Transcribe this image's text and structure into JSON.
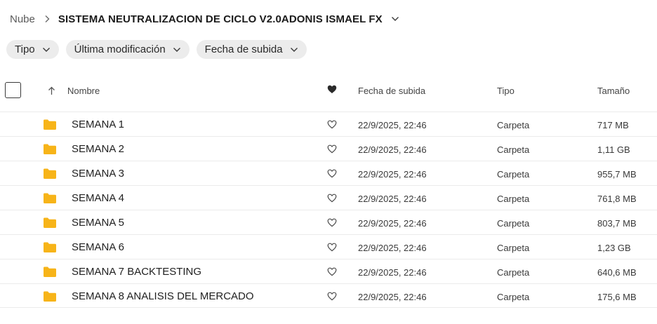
{
  "breadcrumb": {
    "root": "Nube",
    "current": "SISTEMA NEUTRALIZACION DE CICLO V2.0ADONIS ISMAEL FX"
  },
  "filters": [
    {
      "label": "Tipo"
    },
    {
      "label": "Última modificación"
    },
    {
      "label": "Fecha de subida"
    }
  ],
  "table": {
    "headers": {
      "name": "Nombre",
      "date": "Fecha de subida",
      "type": "Tipo",
      "size": "Tamaño"
    },
    "rows": [
      {
        "name": "SEMANA 1",
        "date": "22/9/2025, 22:46",
        "type": "Carpeta",
        "size": "717 MB"
      },
      {
        "name": "SEMANA 2",
        "date": "22/9/2025, 22:46",
        "type": "Carpeta",
        "size": "1,11 GB"
      },
      {
        "name": "SEMANA 3",
        "date": "22/9/2025, 22:46",
        "type": "Carpeta",
        "size": "955,7 MB"
      },
      {
        "name": "SEMANA 4",
        "date": "22/9/2025, 22:46",
        "type": "Carpeta",
        "size": "761,8 MB"
      },
      {
        "name": "SEMANA 5",
        "date": "22/9/2025, 22:46",
        "type": "Carpeta",
        "size": "803,7 MB"
      },
      {
        "name": "SEMANA 6",
        "date": "22/9/2025, 22:46",
        "type": "Carpeta",
        "size": "1,23 GB"
      },
      {
        "name": "SEMANA 7 BACKTESTING",
        "date": "22/9/2025, 22:46",
        "type": "Carpeta",
        "size": "640,6 MB"
      },
      {
        "name": "SEMANA 8 ANALISIS DEL MERCADO",
        "date": "22/9/2025, 22:46",
        "type": "Carpeta",
        "size": "175,6 MB"
      }
    ]
  },
  "icons": {
    "folder": "folder-icon",
    "favorite": "heart-outline-icon",
    "header_favorite": "heart-filled-icon",
    "sort": "arrow-up-icon",
    "chevron": "chevron-down-icon",
    "separator": "chevron-right-icon"
  },
  "colors": {
    "folder": "#f7b419",
    "chip_bg": "#ececec",
    "row_divider": "#ebebeb"
  }
}
